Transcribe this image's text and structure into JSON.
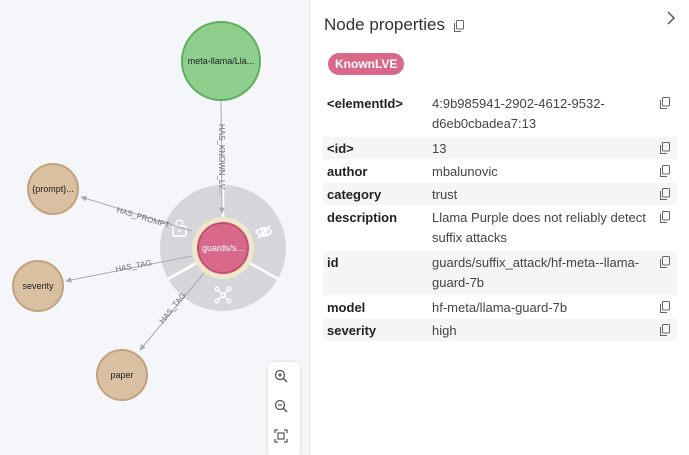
{
  "graph": {
    "nodes": {
      "llama": {
        "label": "meta-llama/Lla...",
        "color": "#8fcf8d",
        "stroke": "#5dae5b"
      },
      "guards": {
        "label": "guards/s...",
        "color": "#d9698b",
        "stroke": "#c24f74"
      },
      "prompt": {
        "label": "{prompt}...",
        "color": "#d8c0a0",
        "stroke": "#c2a27c"
      },
      "severity": {
        "label": "severity",
        "color": "#d8c0a0",
        "stroke": "#c2a27c"
      },
      "paper": {
        "label": "paper",
        "color": "#d8c0a0",
        "stroke": "#c2a27c"
      }
    },
    "edges": {
      "has_known_lve": "HAS_KNOWN_LV...",
      "has_prompt": "HAS_PROMPT",
      "has_tag_severity": "HAS_TAG",
      "has_tag_paper": "HAS_TAG"
    },
    "context_menu": {
      "unlock_icon": "lock-open-icon",
      "hide_icon": "eye-off-icon",
      "expand_icon": "graph-expand-icon"
    },
    "toolbar": {
      "zoom_in_icon": "zoom-in-icon",
      "zoom_out_icon": "zoom-out-icon",
      "fit_icon": "fit-to-screen-icon"
    }
  },
  "panel": {
    "title": "Node properties",
    "label_badge": "KnownLVE",
    "badge_color": "#d9698b",
    "properties": [
      {
        "key": "<elementId>",
        "value": "4:9b985941-2902-4612-9532-d6eb0cbadea7:13"
      },
      {
        "key": "<id>",
        "value": "13"
      },
      {
        "key": "author",
        "value": "mbalunovic"
      },
      {
        "key": "category",
        "value": "trust"
      },
      {
        "key": "description",
        "value": "Llama Purple does not reliably detect suffix attacks"
      },
      {
        "key": "id",
        "value": "guards/suffix_attack/hf-meta--llama-guard-7b"
      },
      {
        "key": "model",
        "value": "hf-meta/llama-guard-7b"
      },
      {
        "key": "severity",
        "value": "high"
      }
    ]
  }
}
